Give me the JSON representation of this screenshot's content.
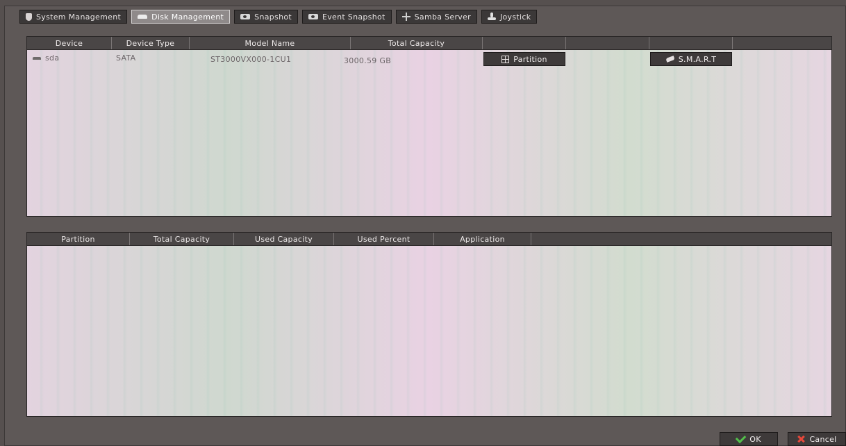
{
  "tabs": [
    {
      "label": "System Management",
      "icon": "shield-icon",
      "active": false
    },
    {
      "label": "Disk Management",
      "icon": "disk-icon",
      "active": true
    },
    {
      "label": "Snapshot",
      "icon": "camera-icon",
      "active": false
    },
    {
      "label": "Event Snapshot",
      "icon": "camera-icon",
      "active": false
    },
    {
      "label": "Samba Server",
      "icon": "network-icon",
      "active": false
    },
    {
      "label": "Joystick",
      "icon": "joystick-icon",
      "active": false
    }
  ],
  "disk_table": {
    "headers": [
      "Device",
      "Device Type",
      "Model Name",
      "Total Capacity",
      "",
      "",
      ""
    ],
    "rows": [
      {
        "device": "sda",
        "device_type": "SATA",
        "model_name": "ST3000VX000-1CU1",
        "total_capacity": "3000.59 GB",
        "partition_button": "Partition",
        "smart_button": "S.M.A.R.T"
      }
    ]
  },
  "partition_table": {
    "headers": [
      "Partition",
      "Total Capacity",
      "Used Capacity",
      "Used Percent",
      "Application"
    ],
    "rows": []
  },
  "footer": {
    "ok_label": "OK",
    "cancel_label": "Cancel"
  },
  "colors": {
    "ok_icon": "#53c04b",
    "cancel_icon": "#e8483a",
    "active_tab": "#8f8a8a"
  }
}
